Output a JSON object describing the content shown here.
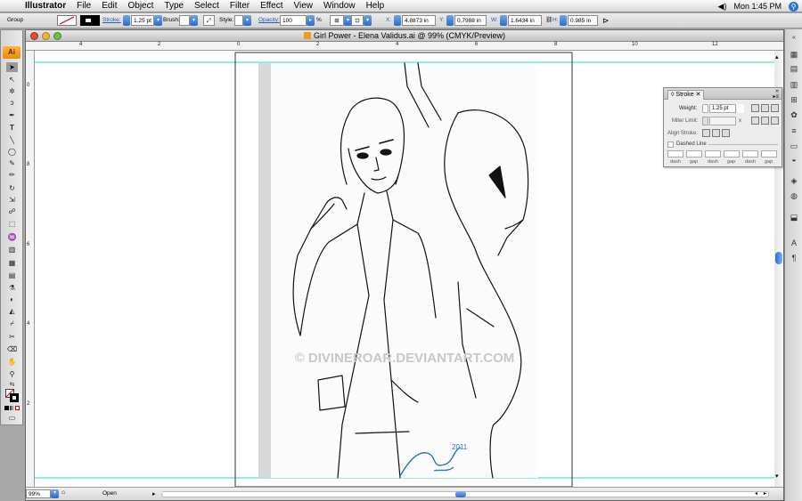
{
  "menubar": {
    "app": "Illustrator",
    "items": [
      "File",
      "Edit",
      "Object",
      "Type",
      "Select",
      "Filter",
      "Effect",
      "View",
      "Window",
      "Help"
    ],
    "clock": "Mon 1:45 PM"
  },
  "control": {
    "selection": "Group",
    "stroke_label": "Stroke:",
    "stroke_value": "1.25 pt",
    "brush_label": "Brush:",
    "style_label": "Style:",
    "opacity_label": "Opacity:",
    "opacity_value": "100",
    "opacity_unit": "%",
    "x_label": "X:",
    "x_value": "4.8873 in",
    "y_label": "Y:",
    "y_value": "0.7988 in",
    "w_label": "W:",
    "w_value": "1.6434 in",
    "h_label": "H:",
    "h_value": "0.985 in"
  },
  "document": {
    "title": "Girl Power - Elena Validus.ai @ 99% (CMYK/Preview)",
    "watermark": "© DIVINEROAR.DEVIANTART.COM",
    "signature": "2011"
  },
  "rulers": {
    "top": [
      "4",
      "2",
      "0",
      "2",
      "4",
      "6",
      "8",
      "10",
      "12"
    ],
    "left": [
      "0",
      "8",
      "6",
      "4",
      "2"
    ]
  },
  "status": {
    "zoom": "99%",
    "state": "Open"
  },
  "stroke_panel": {
    "tab": "Stroke",
    "weight_label": "Weight:",
    "weight_value": "1.25 pt",
    "miter_label": "Miter Limit:",
    "miter_unit": "x",
    "align_label": "Align Stroke:",
    "dashed_label": "Dashed Line",
    "dash_labels": [
      "dash",
      "gap",
      "dash",
      "gap",
      "dash",
      "gap"
    ]
  },
  "colors": {
    "guide": "#2bd0d0",
    "signature": "#2a6fd6",
    "accent": "#2c6bc8"
  }
}
